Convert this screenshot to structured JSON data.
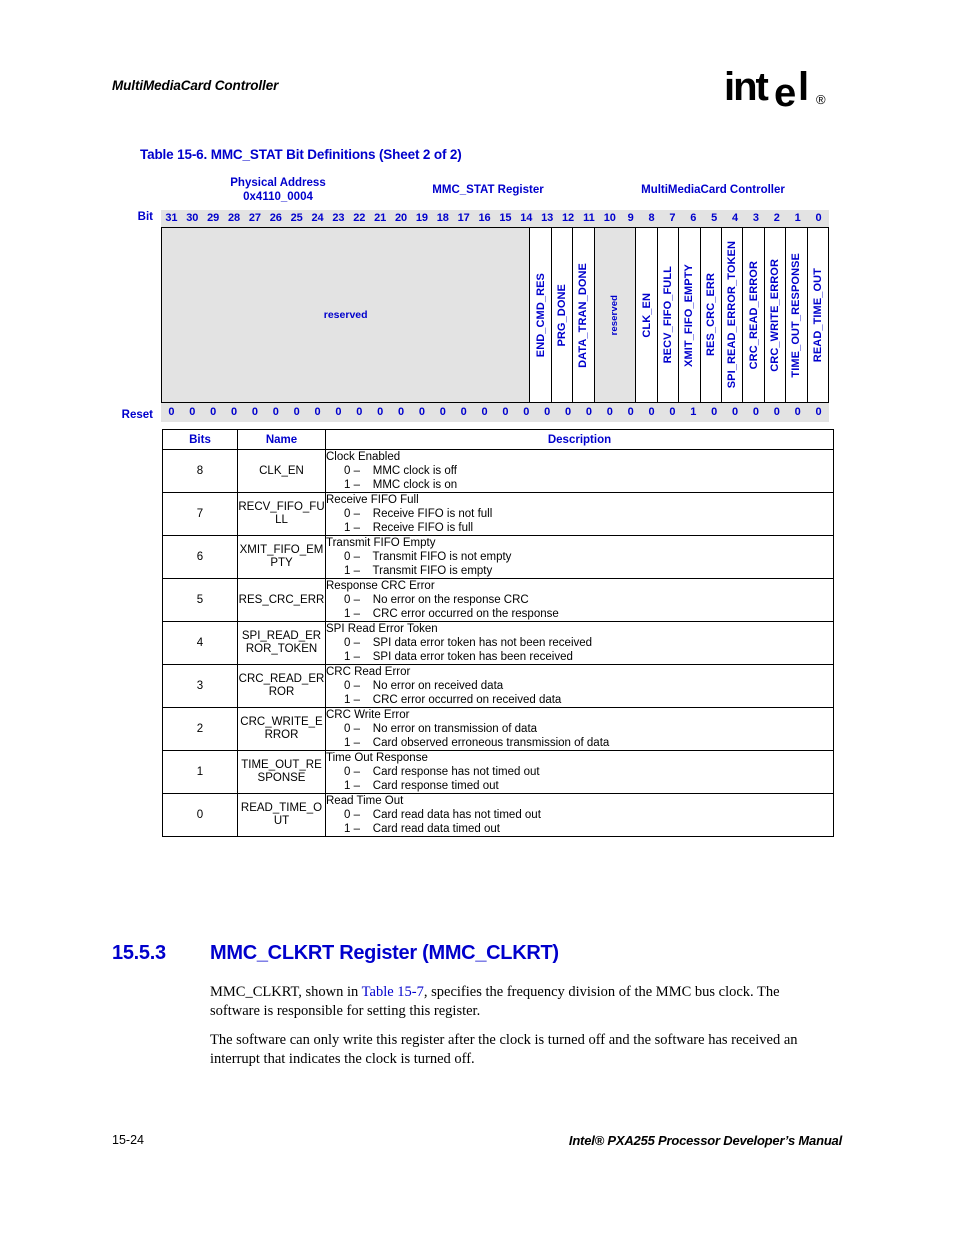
{
  "header": {
    "running_head": "MultiMediaCard Controller",
    "logo_text": "intel",
    "logo_mark": "®"
  },
  "table_caption": "Table 15-6. MMC_STAT Bit Definitions (Sheet 2 of 2)",
  "register_diagram": {
    "physical_address_label": "Physical Address",
    "physical_address_value": "0x4110_0004",
    "register_label": "MMC_STAT Register",
    "unit_label": "MultiMediaCard Controller",
    "bit_row_label": "Bit",
    "reset_row_label": "Reset",
    "bit_numbers": [
      "31",
      "30",
      "29",
      "28",
      "27",
      "26",
      "25",
      "24",
      "23",
      "22",
      "21",
      "20",
      "19",
      "18",
      "17",
      "16",
      "15",
      "14",
      "13",
      "12",
      "11",
      "10",
      "9",
      "8",
      "7",
      "6",
      "5",
      "4",
      "3",
      "2",
      "1",
      "0"
    ],
    "reset_values": [
      "0",
      "0",
      "0",
      "0",
      "0",
      "0",
      "0",
      "0",
      "0",
      "0",
      "0",
      "0",
      "0",
      "0",
      "0",
      "0",
      "0",
      "0",
      "0",
      "0",
      "0",
      "0",
      "0",
      "0",
      "0",
      "1",
      "0",
      "0",
      "0",
      "0",
      "0",
      "0"
    ],
    "fields": [
      {
        "name": "reserved",
        "span": 18,
        "reserved": true,
        "orientation": "horizontal"
      },
      {
        "name": "END_CMD_RES",
        "span": 1,
        "reserved": false,
        "orientation": "vertical"
      },
      {
        "name": "PRG_DONE",
        "span": 1,
        "reserved": false,
        "orientation": "vertical"
      },
      {
        "name": "DATA_TRAN_DONE",
        "span": 1,
        "reserved": false,
        "orientation": "vertical"
      },
      {
        "name": "reserved",
        "span": 2,
        "reserved": true,
        "orientation": "vertical"
      },
      {
        "name": "CLK_EN",
        "span": 1,
        "reserved": false,
        "orientation": "vertical"
      },
      {
        "name": "RECV_FIFO_FULL",
        "span": 1,
        "reserved": false,
        "orientation": "vertical"
      },
      {
        "name": "XMIT_FIFO_EMPTY",
        "span": 1,
        "reserved": false,
        "orientation": "vertical"
      },
      {
        "name": "RES_CRC_ERR",
        "span": 1,
        "reserved": false,
        "orientation": "vertical"
      },
      {
        "name": "SPI_READ_ERROR_TOKEN",
        "span": 1,
        "reserved": false,
        "orientation": "vertical"
      },
      {
        "name": "CRC_READ_ERROR",
        "span": 1,
        "reserved": false,
        "orientation": "vertical"
      },
      {
        "name": "CRC_WRITE_ERROR",
        "span": 1,
        "reserved": false,
        "orientation": "vertical"
      },
      {
        "name": "TIME_OUT_RESPONSE",
        "span": 1,
        "reserved": false,
        "orientation": "vertical"
      },
      {
        "name": "READ_TIME_OUT",
        "span": 1,
        "reserved": false,
        "orientation": "vertical"
      }
    ]
  },
  "desc_table": {
    "columns": [
      "Bits",
      "Name",
      "Description"
    ],
    "rows": [
      {
        "bits": "8",
        "name": "CLK_EN",
        "title": "Clock Enabled",
        "options": [
          "0 –    MMC clock is off",
          "1 –    MMC clock is on"
        ]
      },
      {
        "bits": "7",
        "name": "RECV_FIFO_FULL",
        "title": "Receive FIFO Full",
        "options": [
          "0 –    Receive FIFO is not full",
          "1 –    Receive FIFO is full"
        ]
      },
      {
        "bits": "6",
        "name": "XMIT_FIFO_EMPTY",
        "title": "Transmit FIFO Empty",
        "options": [
          "0 –    Transmit FIFO is not empty",
          "1 –    Transmit FIFO is empty"
        ]
      },
      {
        "bits": "5",
        "name": "RES_CRC_ERR",
        "title": "Response CRC Error",
        "options": [
          "0 –    No error on the response CRC",
          "1 –    CRC error occurred on the response"
        ]
      },
      {
        "bits": "4",
        "name": "SPI_READ_ERROR_TOKEN",
        "title": "SPI Read Error Token",
        "options": [
          "0 –    SPI data error token has not been received",
          "1 –    SPI data error token has been received"
        ]
      },
      {
        "bits": "3",
        "name": "CRC_READ_ERROR",
        "title": "CRC Read Error",
        "options": [
          "0 –    No error on received data",
          "1 –    CRC error occurred on received data"
        ]
      },
      {
        "bits": "2",
        "name": "CRC_WRITE_ERROR",
        "title": "CRC Write Error",
        "options": [
          "0 –    No error on transmission of data",
          "1 –    Card observed erroneous transmission of data"
        ]
      },
      {
        "bits": "1",
        "name": "TIME_OUT_RESPONSE",
        "title": "Time Out Response",
        "options": [
          "0 –    Card response has not timed out",
          "1 –    Card response timed out"
        ]
      },
      {
        "bits": "0",
        "name": "READ_TIME_OUT",
        "title": "Read Time Out",
        "options": [
          "0 –    Card read data has not timed out",
          "1 –    Card read data timed out"
        ]
      }
    ]
  },
  "section": {
    "number": "15.5.3",
    "title": "MMC_CLKRT Register (MMC_CLKRT)",
    "para1_before": "MMC_CLKRT, shown in ",
    "para1_xref": "Table 15-7",
    "para1_after": ", specifies the frequency division of the MMC bus clock. The software is responsible for setting this register.",
    "para2": "The software can only write this register after the clock is turned off and the software has received an interrupt that indicates the clock is turned off."
  },
  "footer": {
    "folio": "15-24",
    "title": "Intel® PXA255 Processor Developer’s Manual"
  }
}
